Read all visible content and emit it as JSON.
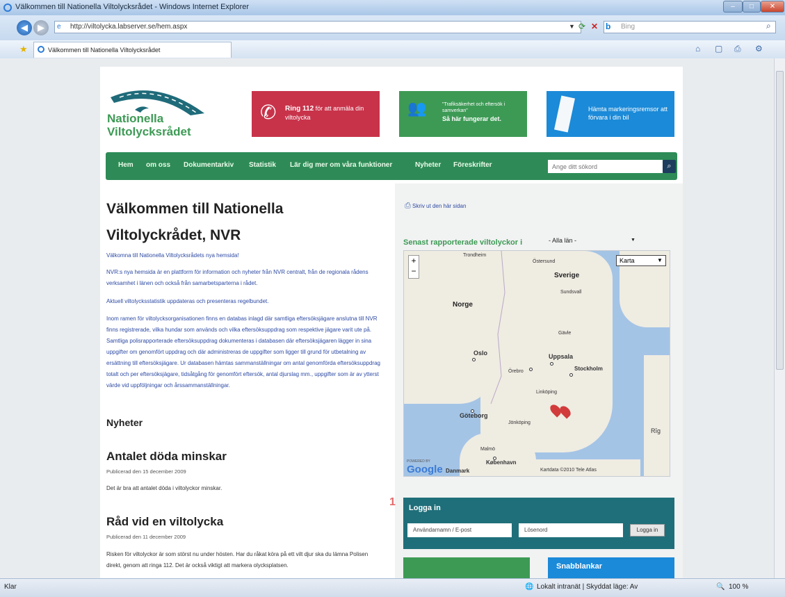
{
  "window": {
    "title": "Välkommen till Nationella Viltolycksrådet - Windows Internet Explorer",
    "url": "http://viltolycka.labserver.se/hem.aspx",
    "search_placeholder": "Bing",
    "tab_title": "Välkommen till Nationella Viltolycksrådet"
  },
  "status": {
    "left": "Klar",
    "zone": "Lokalt intranät | Skyddat läge: Av",
    "zoom": "100 %"
  },
  "header": {
    "logo_line1": "Nationella",
    "logo_line2": "Viltolycksrådet",
    "cta_ring_bold": "Ring 112",
    "cta_ring_text": "för att anmäla din viltolycka",
    "cta_team_quote": "\"Trafiksäkerhet och eftersök i samverkan\"",
    "cta_team_bold": "Så här fungerar det.",
    "cta_remsor": "Hämta markeringsremsor att förvara i din bil",
    "colors": {
      "red": "#c8334a",
      "green": "#3d9a55",
      "blue": "#1b8ad8",
      "nav": "#2e8b57"
    }
  },
  "nav": {
    "items": [
      "Hem",
      "om oss",
      "Dokumentarkiv",
      "Statistik",
      "Lär dig mer om våra funktioner",
      "Nyheter",
      "Föreskrifter"
    ],
    "search_placeholder": "Ange ditt sökord"
  },
  "main": {
    "title_line1": "Välkommen till Nationella",
    "title_line2": "Viltolyckrådet, NVR",
    "intro": "Välkomna till Nationella Viltolycksrådets nya hemsida!",
    "p1": "NVR:s nya hemsida är en plattform för information och nyheter från NVR centralt, från de regionala rådens verksamhet i länen och också från samarbetsparterna i rådet.",
    "p2": "Aktuell viltolycksstatistik uppdateras och presenteras regelbundet.",
    "p3": "Inom ramen för viltolycksorganisationen finns en databas inlagd där samtliga eftersöksjägare anslutna till NVR finns registrerade, vilka hundar som används och vilka eftersöksuppdrag som respektive jägare varit ute på. Samtliga polisrapporterade eftersöksuppdrag dokumenteras i databasen där eftersöksjägaren lägger in sina uppgifter om genomfört uppdrag och där administreras de uppgifter som ligger till grund för utbetalning av ersättning till eftersöksjägare. Ur databasen hämtas sammanställningar om antal genomförda eftersöksuppdrag totalt och per eftersöksjägare, tidsåtgång för genomfört eftersök, antal djurslag mm., uppgifter som är av ytterst värde vid uppföljningar och årssammanställningar.",
    "news_heading": "Nyheter",
    "news": [
      {
        "title": "Antalet döda minskar",
        "date": "Publicerad den 15 december 2009",
        "text": "Det är bra att antalet döda i viltolyckor minskar."
      },
      {
        "title": "Råd vid en viltolycka",
        "date": "Publicerad den 11 december 2009",
        "text": "Risken för viltolyckor är som störst nu under hösten. Har du råkat köra på ett vilt djur ska du lämna Polisen direkt, genom att ringa 112. Det är också viktigt att markera olycksplatsen."
      }
    ]
  },
  "sidebar": {
    "print": "Skriv ut den här sidan",
    "latest_heading": "Senast rapporterade viltolyckor i",
    "county_select": "- Alla län -",
    "map_type": "Karta",
    "map_footer": "Kartdata ©2010 Tele Atlas",
    "map_brand": "Google",
    "map_powered": "POWERED BY",
    "map_labels": {
      "sverige": "Sverige",
      "norge": "Norge",
      "oslo": "Oslo",
      "uppsala": "Uppsala",
      "stockholm": "Stockholm",
      "goteborg": "Göteborg",
      "kobenhavn": "København",
      "danmark": "Danmark",
      "ostersund": "Östersund",
      "sundsvall": "Sundsvall",
      "gavle": "Gävle",
      "orebro": "Örebro",
      "linkoping": "Linköping",
      "jonkoping": "Jönköping",
      "malmo": "Malmö",
      "riga": "Rīg",
      "trondheim": "Trondheim"
    },
    "login_number": "1",
    "login_heading": "Logga in",
    "login_user": "Användarnamn / E-post",
    "login_pass": "Lösenord",
    "login_button": "Logga in",
    "snab": "Snabblankar"
  }
}
